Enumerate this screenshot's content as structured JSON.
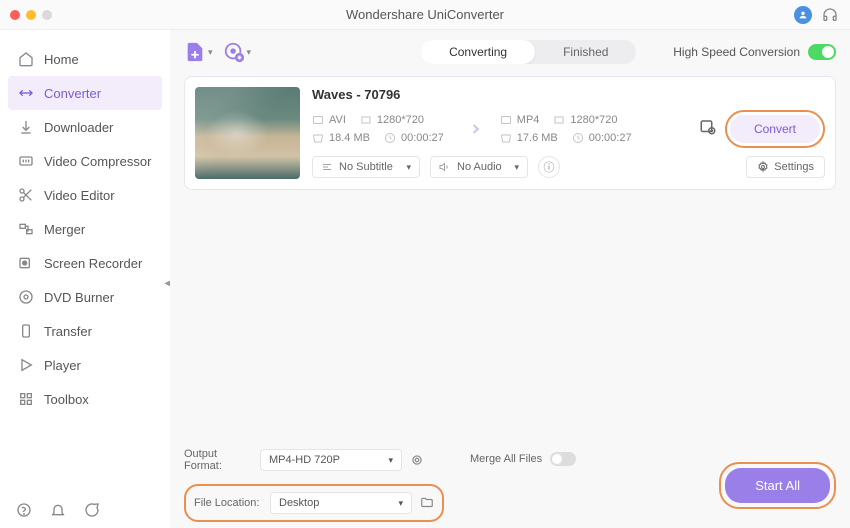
{
  "app": {
    "title": "Wondershare UniConverter"
  },
  "sidebar": {
    "items": [
      {
        "label": "Home",
        "icon": "home"
      },
      {
        "label": "Converter",
        "icon": "converter",
        "active": true
      },
      {
        "label": "Downloader",
        "icon": "download"
      },
      {
        "label": "Video Compressor",
        "icon": "compress"
      },
      {
        "label": "Video Editor",
        "icon": "scissors"
      },
      {
        "label": "Merger",
        "icon": "merger"
      },
      {
        "label": "Screen Recorder",
        "icon": "record"
      },
      {
        "label": "DVD Burner",
        "icon": "disc"
      },
      {
        "label": "Transfer",
        "icon": "transfer"
      },
      {
        "label": "Player",
        "icon": "play"
      },
      {
        "label": "Toolbox",
        "icon": "grid"
      }
    ]
  },
  "tabs": {
    "converting": "Converting",
    "finished": "Finished"
  },
  "speed": {
    "label": "High Speed Conversion"
  },
  "file": {
    "title": "Waves - 70796",
    "src": {
      "format": "AVI",
      "res": "1280*720",
      "size": "18.4 MB",
      "duration": "00:00:27"
    },
    "dst": {
      "format": "MP4",
      "res": "1280*720",
      "size": "17.6 MB",
      "duration": "00:00:27"
    },
    "subtitle": "No Subtitle",
    "audio": "No Audio",
    "settings_label": "Settings",
    "convert_label": "Convert"
  },
  "footer": {
    "output_label": "Output Format:",
    "output_value": "MP4-HD 720P",
    "location_label": "File Location:",
    "location_value": "Desktop",
    "merge_label": "Merge All Files",
    "start_label": "Start All"
  }
}
